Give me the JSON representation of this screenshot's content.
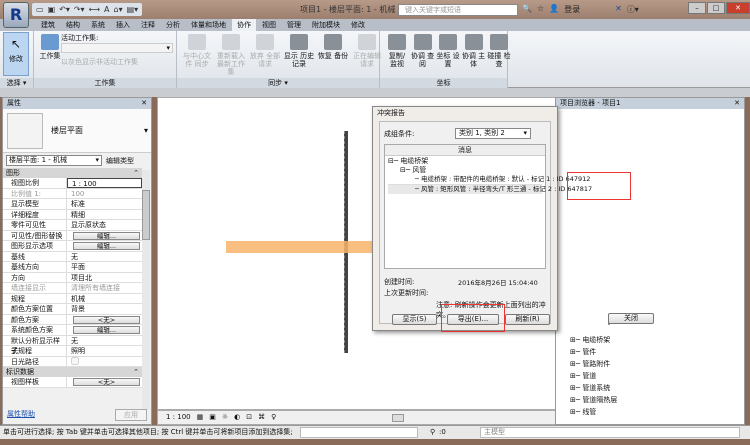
{
  "app": {
    "logo": "R",
    "title": "项目1 - 楼层平面: 1 - 机械",
    "search_placeholder": "键入关键字或短语",
    "login": "登录"
  },
  "tabs": [
    "建筑",
    "结构",
    "系统",
    "插入",
    "注释",
    "分析",
    "体量和场地",
    "协作",
    "视图",
    "管理",
    "附加模块",
    "修改"
  ],
  "active_tab": "协作",
  "ribbon": {
    "select": {
      "modify": "修改",
      "label": "选择 ▾"
    },
    "worksets": {
      "worksets_btn": "工作集",
      "active_label": "活动工作集:",
      "gray_display": "以灰色显示非活动工作集",
      "label": "工作集"
    },
    "sync": {
      "buttons": [
        "与中心文件 同步",
        "重新载入 最新工作集",
        "放弃 全部请求",
        "显示 历史记录",
        "恢复 备份",
        "正在编辑 请求"
      ],
      "label": "同步 ▾"
    },
    "coord": {
      "buttons": [
        "复制/ 监视",
        "协调 查阅",
        "坐标 设置",
        "协调 主体",
        "碰撞 检查"
      ],
      "label": "坐标"
    }
  },
  "properties": {
    "title": "属性",
    "type_name": "楼层平面",
    "view_selector": "楼层平面: 1 - 机械",
    "edit_type": "编辑类型",
    "sections": [
      {
        "name": "图形",
        "rows": [
          [
            "视图比例",
            "1 : 100"
          ],
          [
            "比例值 1:",
            "100"
          ],
          [
            "显示模型",
            "标准"
          ],
          [
            "详细程度",
            "精细"
          ],
          [
            "零件可见性",
            "显示原状态"
          ],
          [
            "可见性/图形替换",
            "编辑..."
          ],
          [
            "图形显示选项",
            "编辑..."
          ],
          [
            "基线",
            "无"
          ],
          [
            "基线方向",
            "平面"
          ],
          [
            "方向",
            "项目北"
          ],
          [
            "墙连接显示",
            "清理所有墙连接"
          ],
          [
            "规程",
            "机械"
          ],
          [
            "颜色方案位置",
            "背景"
          ],
          [
            "颜色方案",
            "<无>"
          ],
          [
            "系统颜色方案",
            "编辑..."
          ],
          [
            "默认分析显示样式",
            "无"
          ],
          [
            "子规程",
            "照明"
          ],
          [
            "日光路径",
            ""
          ]
        ]
      },
      {
        "name": "标识数据",
        "rows": [
          [
            "视图样板",
            "<无>"
          ]
        ]
      }
    ],
    "help": "属性帮助",
    "apply": "应用"
  },
  "dialog": {
    "title": "冲突报告",
    "group_label": "成组条件:",
    "group_value": "类别 1, 类别 2",
    "col_header": "消息",
    "tree": [
      "电缆桥架",
      "风管",
      "电缆桥架 : 带配件的电缆桥架 : 默认 - 标记 1 : ID 647912",
      "风管 : 矩形风管 : 半径弯头/T 形三通 - 标记 2 : ID 647817"
    ],
    "created_label": "创建时间:",
    "created_value": "2016年8月26日  15:04:40",
    "updated_label": "上次更新时间:",
    "note": "注意: 刷新操作会更新上面列出的冲突。",
    "buttons": {
      "show": "显示(S)",
      "export": "导出(E)...",
      "refresh": "刷新(R)",
      "close": "关闭"
    }
  },
  "browser": {
    "title": "项目浏览器 - 项目1",
    "items": [
      "电缆桥架",
      "管件",
      "管路附件",
      "管道",
      "管道系统",
      "管道隔热层",
      "线管"
    ]
  },
  "viewbar": {
    "scale": "1 : 100"
  },
  "status": {
    "text": "单击可进行选择; 按 Tab 键并单击可选择其他项目; 按 Ctrl 键并单击可将新项目添加到选择集;",
    "count": ":0",
    "model": "主模型"
  },
  "colors": {
    "duct": "#f7b46a",
    "highlight": "#e33333"
  }
}
